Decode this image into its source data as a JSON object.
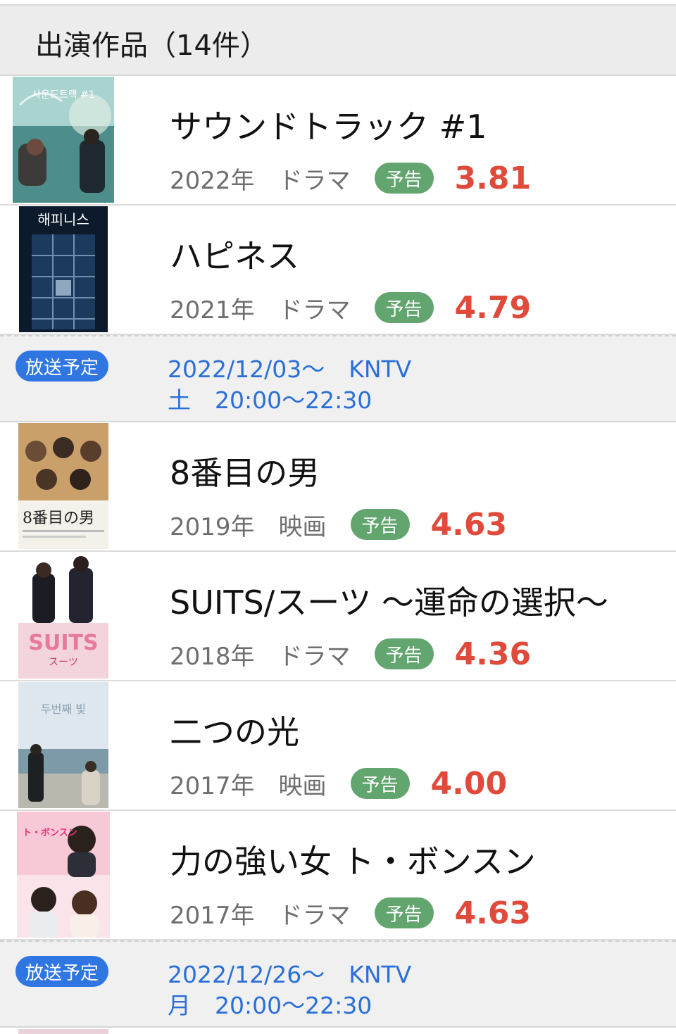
{
  "section": {
    "title": "出演作品（14件）"
  },
  "trailer_label": "予告",
  "broadcast_badge": "放送予定",
  "works": [
    {
      "title": "サウンドトラック #1",
      "year": "2022年",
      "genre": "ドラマ",
      "rating": "3.81"
    },
    {
      "title": "ハピネス",
      "year": "2021年",
      "genre": "ドラマ",
      "rating": "4.79",
      "broadcast": {
        "start": "2022/12/03〜",
        "channel": "KNTV",
        "day": "土",
        "time": "20:00〜22:30"
      }
    },
    {
      "title": "8番目の男",
      "year": "2019年",
      "genre": "映画",
      "rating": "4.63"
    },
    {
      "title": "SUITS/スーツ ～運命の選択～",
      "year": "2018年",
      "genre": "ドラマ",
      "rating": "4.36"
    },
    {
      "title": "二つの光",
      "year": "2017年",
      "genre": "映画",
      "rating": "4.00"
    },
    {
      "title": "力の強い女 ト・ボンスン",
      "year": "2017年",
      "genre": "ドラマ",
      "rating": "4.63",
      "broadcast": {
        "start": "2022/12/26〜",
        "channel": "KNTV",
        "day": "月",
        "time": "20:00〜22:30"
      }
    }
  ],
  "poster_texts": [
    "사운드트랙 #1",
    "해피니스",
    "8番目の男",
    "SUITS",
    "スーツ",
    "두번째 빛",
    "ト・ボンスン"
  ],
  "colors": {
    "rating": "#e04a3a",
    "trailer_badge": "#62a56e",
    "broadcast_badge": "#2f76e3",
    "broadcast_text": "#2a6fd8",
    "header_bg": "#ececec"
  }
}
